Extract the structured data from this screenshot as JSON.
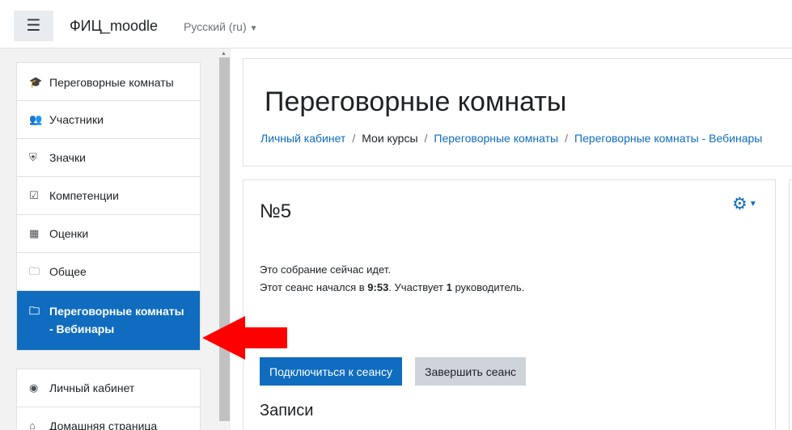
{
  "header": {
    "menu_icon": "hamburger-icon",
    "site_name": "ФИЦ_moodle",
    "language": "Русский ‎(ru)‎"
  },
  "sidebar": {
    "items": [
      {
        "icon": "graduation-cap-icon",
        "label": "Переговорные комнаты"
      },
      {
        "icon": "users-icon",
        "label": "Участники"
      },
      {
        "icon": "shield-icon",
        "label": "Значки"
      },
      {
        "icon": "check-square-icon",
        "label": "Компетенции"
      },
      {
        "icon": "table-icon",
        "label": "Оценки"
      },
      {
        "icon": "folder-icon",
        "label": "Общее"
      },
      {
        "icon": "folder-icon",
        "label": "Переговорные комнаты - Вебинары",
        "active": true
      }
    ],
    "items2": [
      {
        "icon": "dashboard-icon",
        "label": "Личный кабинет"
      },
      {
        "icon": "home-icon",
        "label": "Домашняя страница"
      }
    ]
  },
  "page": {
    "title": "Переговорные комнаты",
    "breadcrumb": [
      "Личный кабинет",
      "Мои курсы",
      "Переговорные комнаты",
      "Переговорные комнаты - Вебинары"
    ]
  },
  "activity": {
    "title": "№5",
    "status_line1": "Это собрание сейчас идет.",
    "status_line2_prefix": "Этот сеанс начался в ",
    "start_time": "9:53",
    "status_line2_mid": ". Участвует ",
    "moderators": "1",
    "status_line2_suffix": " руководитель.",
    "join_button": "Подключиться к сеансу",
    "end_button": "Завершить сеанс",
    "recordings_title": "Записи"
  },
  "colors": {
    "primary": "#0f6cbf",
    "annotation_arrow": "#ff0000"
  }
}
